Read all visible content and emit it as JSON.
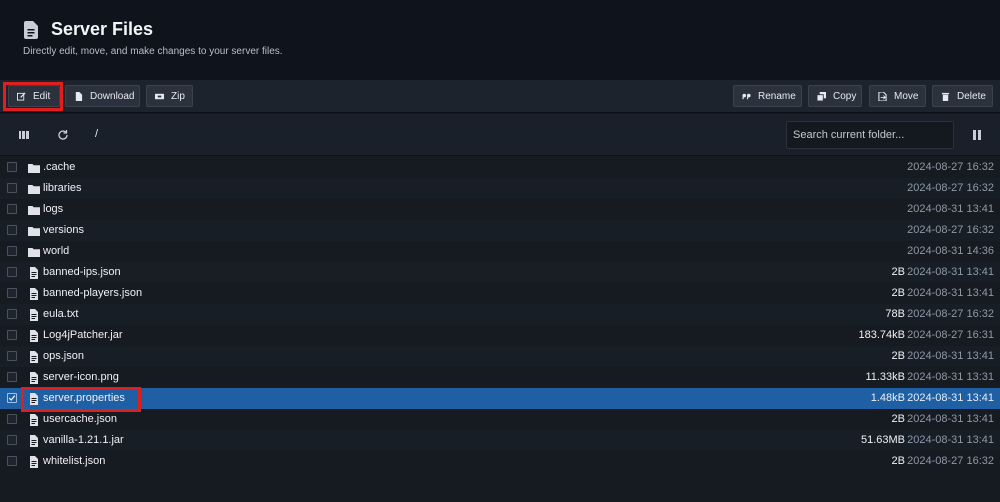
{
  "header": {
    "title": "Server Files",
    "subtitle": "Directly edit, move, and make changes to your server files."
  },
  "toolbar": {
    "edit": "Edit",
    "download": "Download",
    "zip": "Zip",
    "rename": "Rename",
    "copy": "Copy",
    "move": "Move",
    "delete": "Delete"
  },
  "pathbar": {
    "path": "/",
    "search_placeholder": "Search current folder..."
  },
  "files": [
    {
      "name": ".cache",
      "type": "folder",
      "size": "",
      "date": "2024-08-27 16:32",
      "selected": false
    },
    {
      "name": "libraries",
      "type": "folder",
      "size": "",
      "date": "2024-08-27 16:32",
      "selected": false
    },
    {
      "name": "logs",
      "type": "folder",
      "size": "",
      "date": "2024-08-31 13:41",
      "selected": false
    },
    {
      "name": "versions",
      "type": "folder",
      "size": "",
      "date": "2024-08-27 16:32",
      "selected": false
    },
    {
      "name": "world",
      "type": "folder",
      "size": "",
      "date": "2024-08-31 14:36",
      "selected": false
    },
    {
      "name": "banned-ips.json",
      "type": "file",
      "size": "2B",
      "date": "2024-08-31 13:41",
      "selected": false
    },
    {
      "name": "banned-players.json",
      "type": "file",
      "size": "2B",
      "date": "2024-08-31 13:41",
      "selected": false
    },
    {
      "name": "eula.txt",
      "type": "file",
      "size": "78B",
      "date": "2024-08-27 16:32",
      "selected": false
    },
    {
      "name": "Log4jPatcher.jar",
      "type": "file",
      "size": "183.74kB",
      "date": "2024-08-27 16:31",
      "selected": false
    },
    {
      "name": "ops.json",
      "type": "file",
      "size": "2B",
      "date": "2024-08-31 13:41",
      "selected": false
    },
    {
      "name": "server-icon.png",
      "type": "file",
      "size": "11.33kB",
      "date": "2024-08-31 13:31",
      "selected": false
    },
    {
      "name": "server.properties",
      "type": "file",
      "size": "1.48kB",
      "date": "2024-08-31 13:41",
      "selected": true
    },
    {
      "name": "usercache.json",
      "type": "file",
      "size": "2B",
      "date": "2024-08-31 13:41",
      "selected": false
    },
    {
      "name": "vanilla-1.21.1.jar",
      "type": "file",
      "size": "51.63MB",
      "date": "2024-08-31 13:41",
      "selected": false
    },
    {
      "name": "whitelist.json",
      "type": "file",
      "size": "2B",
      "date": "2024-08-27 16:32",
      "selected": false
    }
  ],
  "colors": {
    "selected_row": "#1f5fa3",
    "highlight": "#e01e1e"
  }
}
